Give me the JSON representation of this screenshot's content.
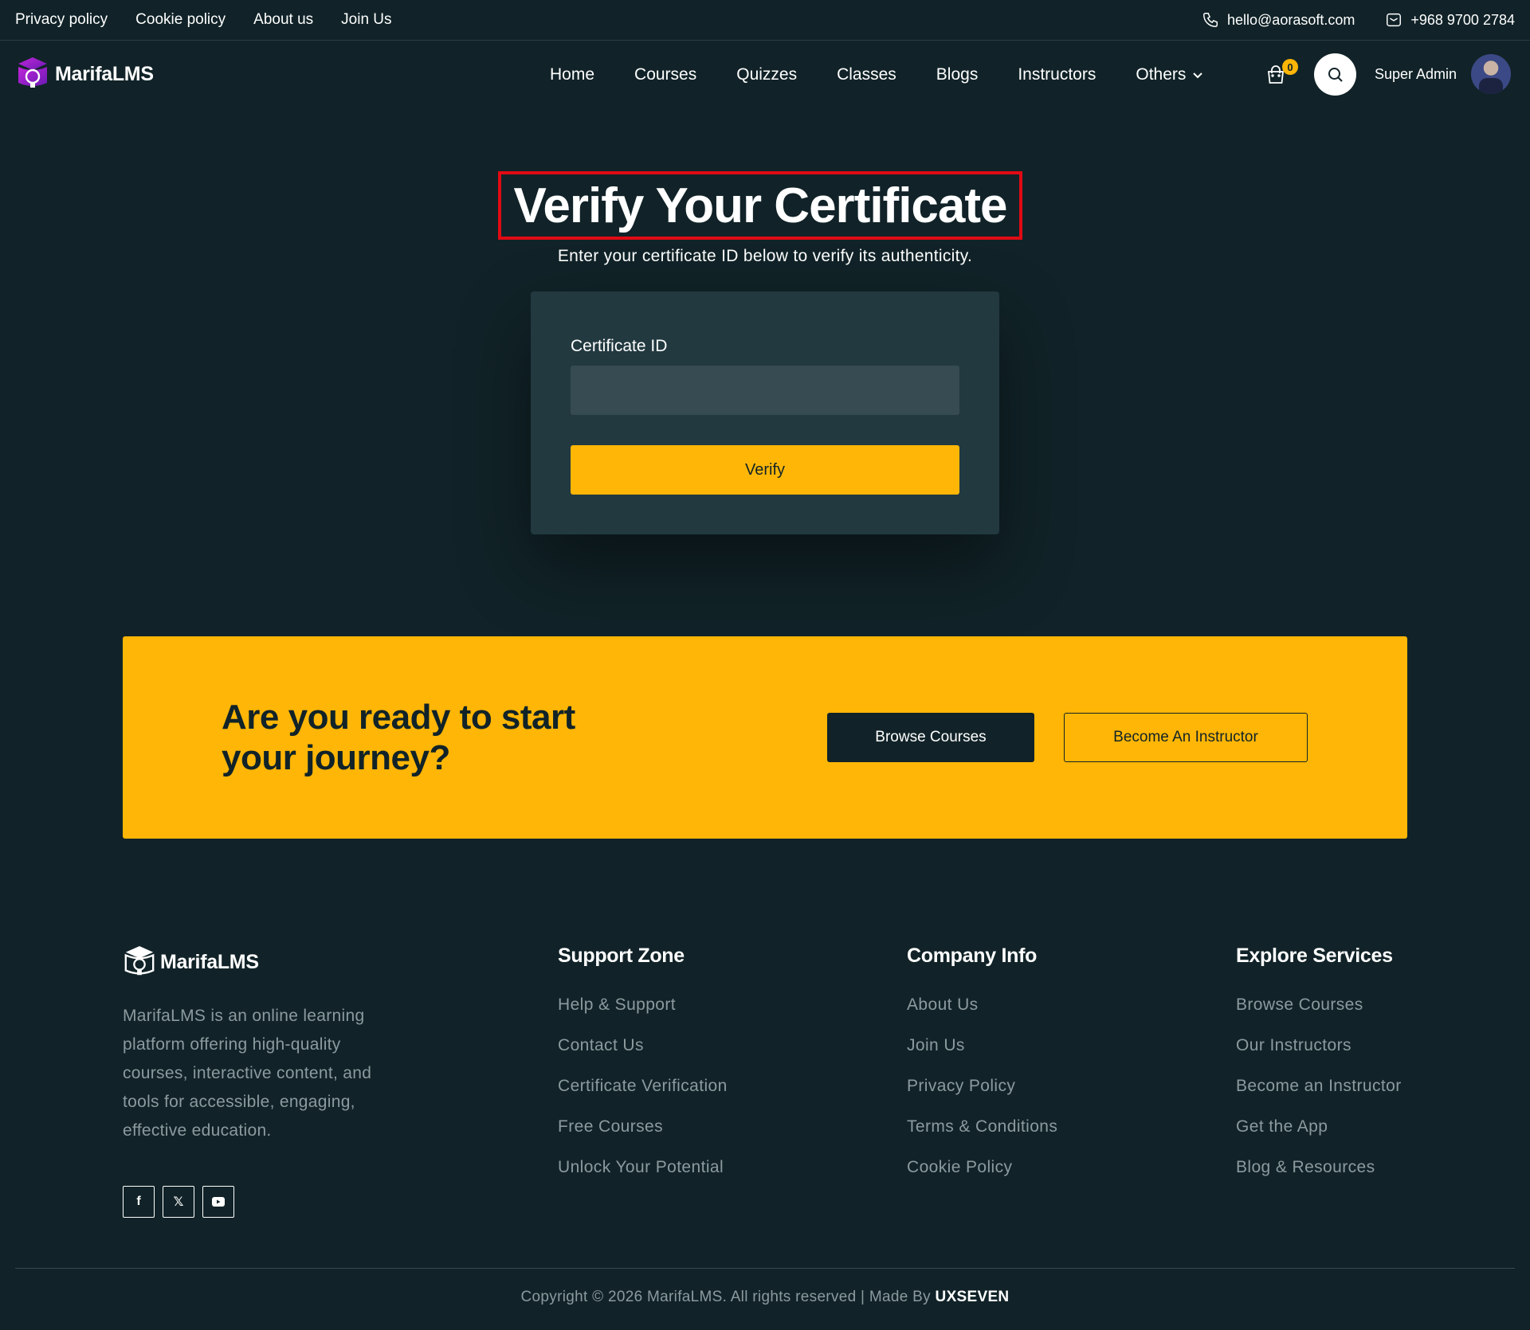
{
  "topbar": {
    "links": [
      "Privacy policy",
      "Cookie policy",
      "About us",
      "Join Us"
    ],
    "email": "hello@aorasoft.com",
    "phone": "+968 9700 2784"
  },
  "nav": {
    "logo": "MarifaLMS",
    "menu": [
      "Home",
      "Courses",
      "Quizzes",
      "Classes",
      "Blogs",
      "Instructors",
      "Others"
    ],
    "cart_count": "0",
    "user_name": "Super Admin"
  },
  "hero": {
    "title": "Verify Your Certificate",
    "subtitle": "Enter your certificate ID below to verify its authenticity.",
    "field_label": "Certificate ID",
    "field_value": "",
    "verify_label": "Verify"
  },
  "cta": {
    "heading": "Are you ready to start your journey?",
    "browse_label": "Browse Courses",
    "instructor_label": "Become An Instructor"
  },
  "footer": {
    "logo": "MarifaLMS",
    "about": "MarifaLMS is an online learning platform offering high-quality courses, interactive content, and tools for accessible, engaging, effective education.",
    "socials": [
      "facebook-icon",
      "x-icon",
      "youtube-icon"
    ],
    "columns": [
      {
        "title": "Support Zone",
        "items": [
          "Help & Support",
          "Contact Us",
          "Certificate Verification",
          "Free Courses",
          "Unlock Your Potential"
        ]
      },
      {
        "title": "Company Info",
        "items": [
          "About Us",
          "Join Us",
          "Privacy Policy",
          "Terms & Conditions",
          "Cookie Policy"
        ]
      },
      {
        "title": "Explore Services",
        "items": [
          "Browse Courses",
          "Our Instructors",
          "Become an Instructor",
          "Get the App",
          "Blog & Resources"
        ]
      }
    ],
    "copyright": "Copyright © 2026 MarifaLMS. All rights reserved | Made By",
    "made_by": "UXSEVEN"
  },
  "colors": {
    "background": "#112328",
    "accent": "#ffb606",
    "card": "#223940",
    "muted_text": "#8c9a9e",
    "highlight_border": "#e10a14"
  }
}
